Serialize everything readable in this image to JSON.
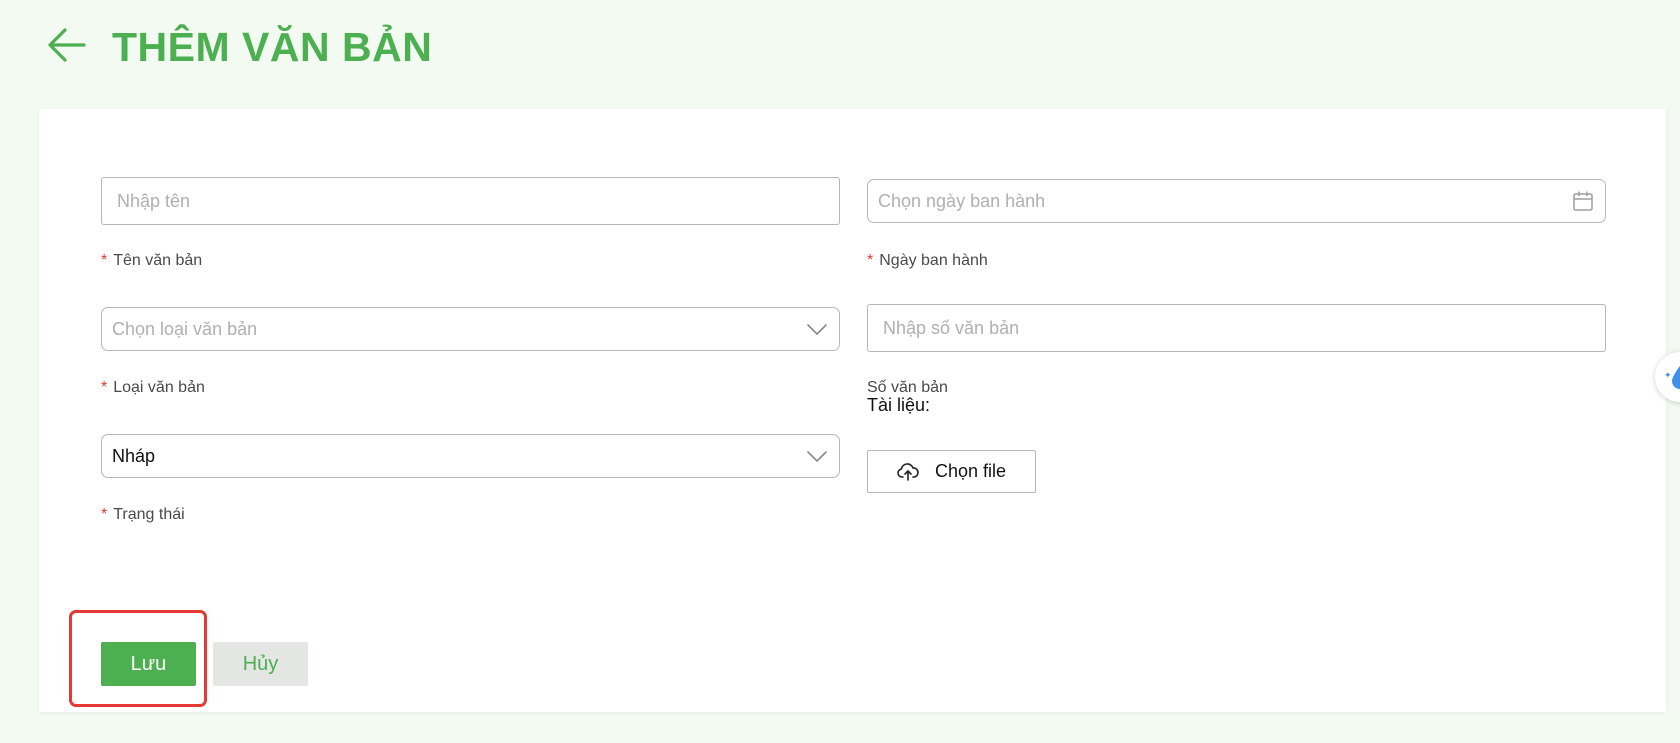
{
  "header": {
    "title": "THÊM VĂN BẢN"
  },
  "form": {
    "required_mark": "*",
    "name": {
      "label": "Tên văn bản",
      "placeholder": "Nhập tên"
    },
    "issue_date": {
      "label": "Ngày ban hành",
      "placeholder": "Chọn ngày ban hành"
    },
    "doc_type": {
      "label": "Loại văn bản",
      "placeholder": "Chọn loại văn bản"
    },
    "doc_number": {
      "label": "Số văn bản",
      "placeholder": "Nhập số văn bản"
    },
    "status": {
      "label": "Trạng thái",
      "value": "Nháp"
    },
    "attachment": {
      "label": "Tài liệu:",
      "button_label": "Chọn file"
    }
  },
  "actions": {
    "save_label": "Lưu",
    "cancel_label": "Hủy"
  },
  "colors": {
    "brand": "#4caf50",
    "required": "#e53935",
    "highlight": "#e53935",
    "background": "#f2faf1"
  },
  "icons": {
    "back": "arrow-left-icon",
    "calendar": "calendar-icon",
    "chevron": "chevron-down-icon",
    "upload": "cloud-upload-icon",
    "widget": "water-drop-icon"
  }
}
